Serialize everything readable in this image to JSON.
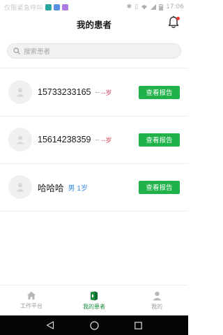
{
  "status_bar": {
    "carrier": "仅限紧急呼叫",
    "time": "17:06"
  },
  "header": {
    "title": "我的患者"
  },
  "search": {
    "placeholder": "搜索患者"
  },
  "patients": [
    {
      "name": "15733233165",
      "sex": "--",
      "age": "--岁",
      "action": "查看报告"
    },
    {
      "name": "15614238359",
      "sex": "--",
      "age": "--岁",
      "action": "查看报告"
    },
    {
      "name": "哈哈哈",
      "sex": "男",
      "age": "1岁",
      "action": "查看报告"
    }
  ],
  "tabs": [
    {
      "label": "工作平台",
      "icon": "home-icon",
      "active": false
    },
    {
      "label": "我的患者",
      "icon": "patients-icon",
      "active": true
    },
    {
      "label": "我的",
      "icon": "person-icon",
      "active": false
    }
  ],
  "colors": {
    "accent_green": "#1fb24a",
    "active_tab": "#1a8f3e",
    "age_red": "#d0405a",
    "info_blue": "#3a8ee6"
  }
}
